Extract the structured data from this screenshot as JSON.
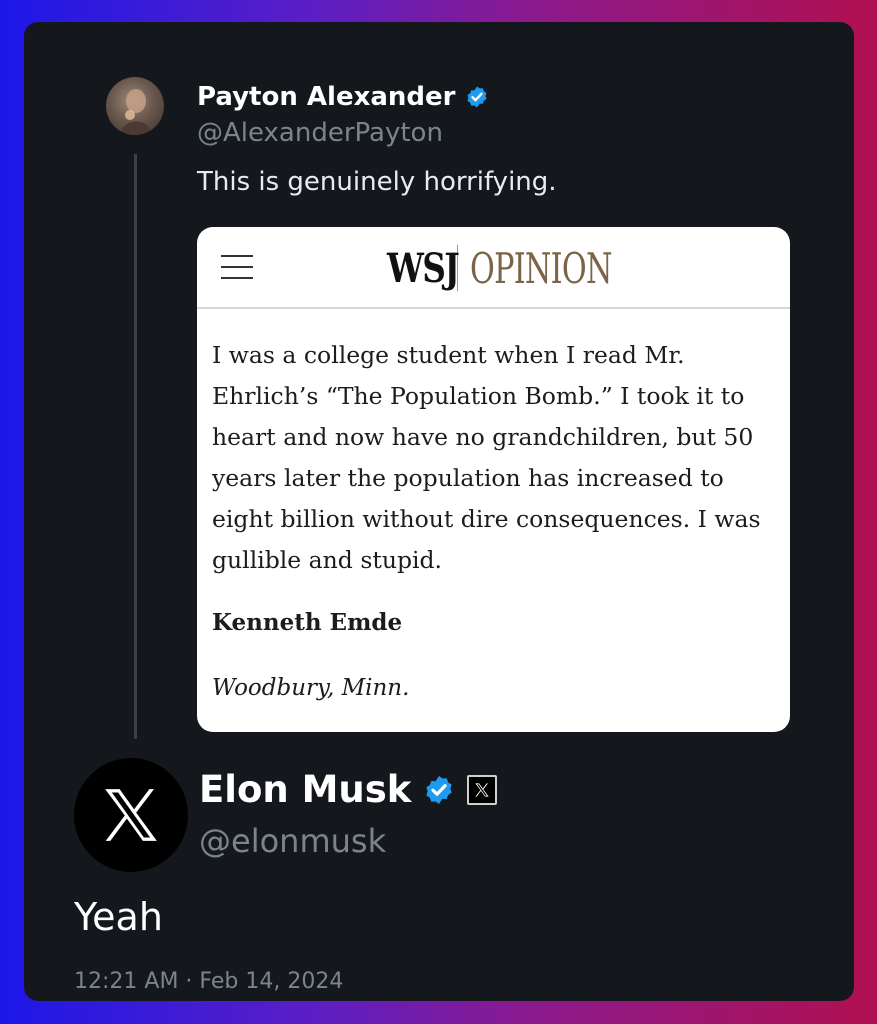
{
  "colors": {
    "card_background": "#14171c",
    "verified_blue": "#1d9bf0",
    "muted_text": "#7b848d",
    "opinion_brown": "#7a6548"
  },
  "quoted_tweet": {
    "avatar_icon": "user-avatar-photo",
    "author_name": "Payton Alexander",
    "verified_icon": "verified-badge-icon",
    "handle": "@AlexanderPayton",
    "text": "This is genuinely horrifying.",
    "embed": {
      "menu_icon": "hamburger-menu-icon",
      "logo_wsj": "WSJ",
      "logo_section": "OPINION",
      "letter_text": "I was a college student when I read Mr. Ehrlich’s “The Population Bomb.” I took it to heart and now have no grandchildren, but 50 years later the population has increased to eight billion without dire consequences. I was gullible and stupid.",
      "author": "Kenneth Emde",
      "location": "Woodbury, Minn."
    }
  },
  "main_tweet": {
    "avatar_icon": "x-logo-icon",
    "author_name": "Elon Musk",
    "verified_icon": "verified-badge-icon",
    "affiliate_icon": "x-affiliate-badge-icon",
    "handle": "@elonmusk",
    "text": "Yeah",
    "timestamp": "12:21 AM · Feb 14, 2024"
  }
}
